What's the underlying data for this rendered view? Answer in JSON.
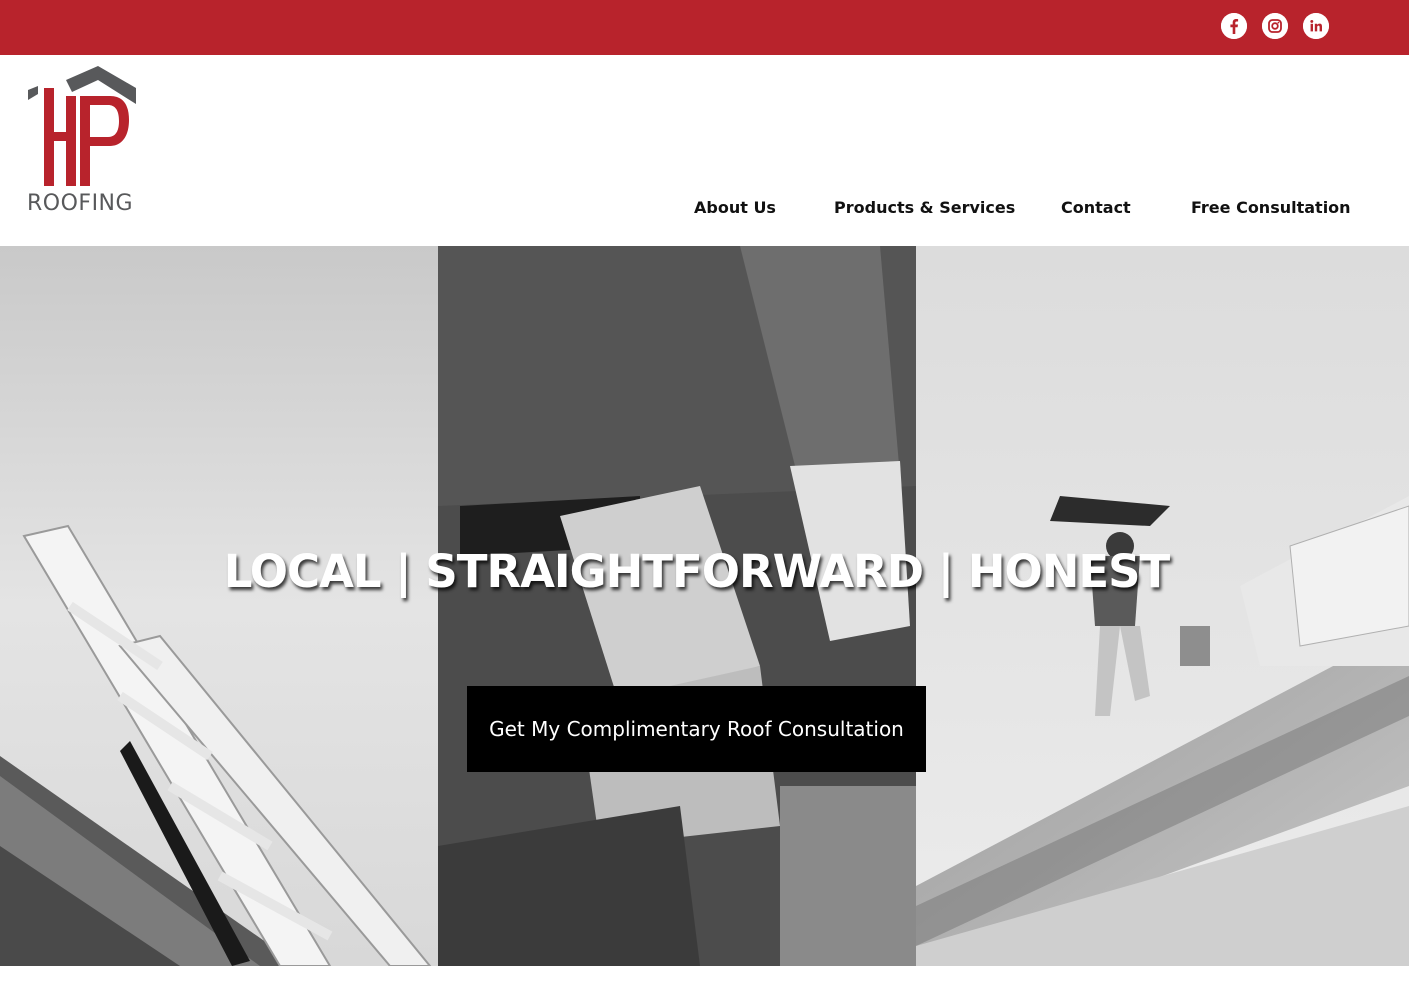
{
  "colors": {
    "brand_red": "#b8232c",
    "logo_gray": "#58595b",
    "cta_bg": "#000000",
    "cta_text": "#ffffff"
  },
  "social": {
    "facebook_icon": "facebook-icon",
    "instagram_icon": "instagram-icon",
    "linkedin_icon": "linkedin-icon"
  },
  "logo": {
    "letters": "HP",
    "wordmark": "ROOFING"
  },
  "nav": {
    "items": [
      {
        "label": "About Us"
      },
      {
        "label": "Products & Services"
      },
      {
        "label": "Contact"
      },
      {
        "label": "Free Consultation"
      }
    ]
  },
  "hero": {
    "headline": "LOCAL | STRAIGHTFORWARD | HONEST",
    "cta_label": "Get My Complimentary Roof Consultation"
  }
}
